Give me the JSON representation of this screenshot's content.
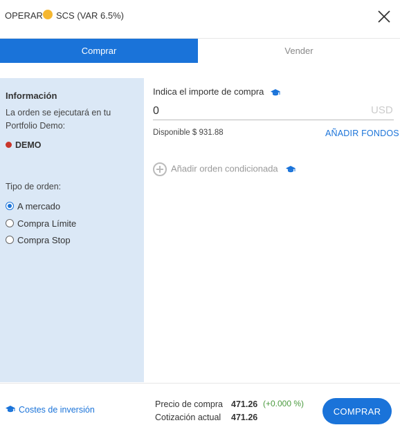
{
  "header": {
    "mode_label": "OPERAR",
    "asset_label": "SCS (VAR 6.5%)",
    "coin_color": "#f5b731",
    "close_icon": "close-icon"
  },
  "tabs": [
    {
      "label": "Comprar",
      "active": true
    },
    {
      "label": "Vender",
      "active": false
    }
  ],
  "sidebar": {
    "info_title": "Información",
    "info_text": "La orden se ejecutará en tu Portfolio Demo:",
    "account_label": "DEMO",
    "account_dot_color": "#c9362b",
    "order_type_label": "Tipo de orden:",
    "order_types": [
      {
        "label": "A mercado",
        "selected": true
      },
      {
        "label": "Compra Límite",
        "selected": false
      },
      {
        "label": "Compra Stop",
        "selected": false
      }
    ]
  },
  "main": {
    "amount_label": "Indica el importe de compra",
    "amount_value": "0",
    "currency": "USD",
    "available": "Disponible $ 931.88",
    "add_funds_label": "AÑADIR FONDOS",
    "conditional_order_label": "Añadir orden condicionada"
  },
  "footer": {
    "costs_label": "Costes de inversión",
    "buy_price_label": "Precio de compra",
    "buy_price_value": "471.26",
    "buy_price_change": "(+0.000 %)",
    "current_quote_label": "Cotización actual",
    "current_quote_value": "471.26",
    "buy_button_label": "COMPRAR"
  },
  "colors": {
    "accent": "#1a73d9",
    "sidebar_bg": "#dbe8f6",
    "positive": "#4a9a3e"
  }
}
